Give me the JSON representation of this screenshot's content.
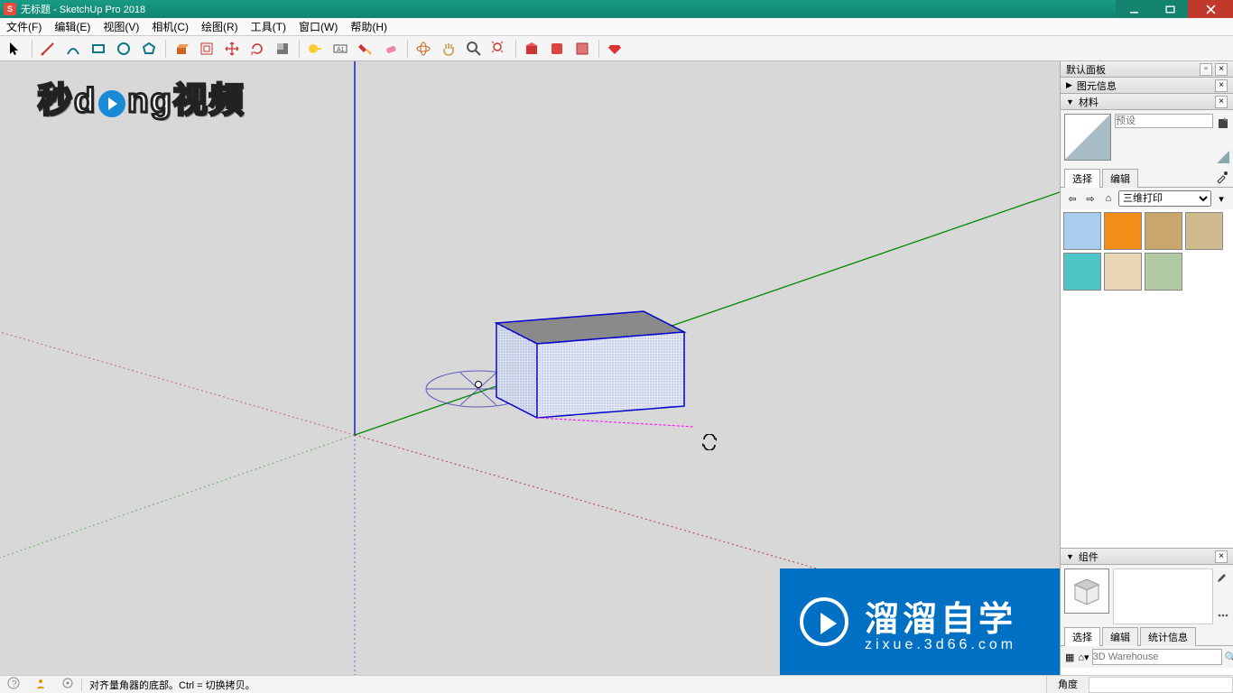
{
  "title": "无标题 - SketchUp Pro 2018",
  "menus": [
    "文件(F)",
    "编辑(E)",
    "视图(V)",
    "相机(C)",
    "绘图(R)",
    "工具(T)",
    "窗口(W)",
    "帮助(H)"
  ],
  "statusbar": {
    "hint": "对齐量角器的底部。Ctrl = 切换拷贝。",
    "measure_label": "角度",
    "measure_value": ""
  },
  "panel": {
    "title": "默认面板",
    "entity_info": "图元信息",
    "materials": {
      "title": "材料",
      "preset_placeholder": "预设",
      "tab_select": "选择",
      "tab_edit": "编辑",
      "category": "三维打印",
      "swatches": [
        "#a8cdee",
        "#f28d1a",
        "#c9a66b",
        "#cfb98f",
        "#4fc5c7",
        "#e8d6b5",
        "#b2caa3"
      ]
    },
    "components": {
      "title": "组件",
      "tab_select": "选择",
      "tab_edit": "编辑",
      "tab_stats": "统计信息",
      "search_placeholder": "3D Warehouse"
    }
  },
  "overlay": {
    "logo_text_left": "秒",
    "logo_text_mid": "d",
    "logo_text_right_a": "ng",
    "logo_text_right_b": "视频",
    "brand_cn": "溜溜自学",
    "brand_url": "zixue.3d66.com"
  }
}
